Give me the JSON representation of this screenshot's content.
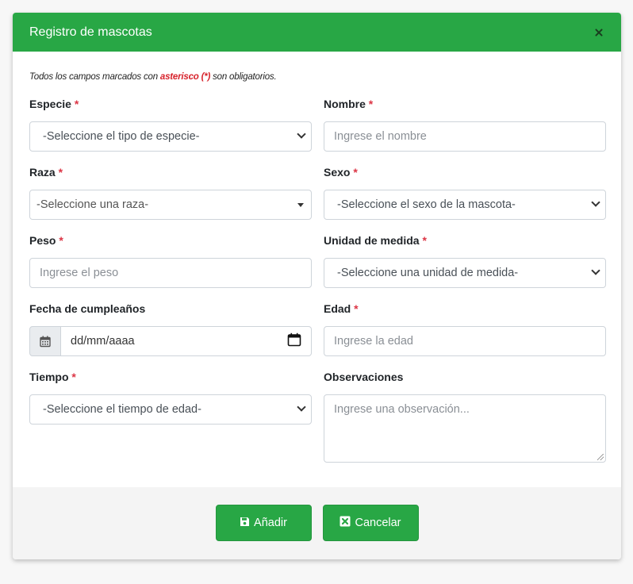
{
  "modal": {
    "title": "Registro de mascotas"
  },
  "note": {
    "prefix": "Todos los campos marcados con ",
    "highlight": "asterisco (*)",
    "suffix": " son obligatorios."
  },
  "fields": {
    "especie": {
      "label": "Especie",
      "required_mark": "*",
      "value": "-Seleccione el tipo de especie-"
    },
    "nombre": {
      "label": "Nombre",
      "required_mark": "*",
      "placeholder": "Ingrese el nombre"
    },
    "raza": {
      "label": "Raza",
      "required_mark": "*",
      "value": "-Seleccione una raza-"
    },
    "sexo": {
      "label": "Sexo",
      "required_mark": "*",
      "value": "-Seleccione el sexo de la mascota-"
    },
    "peso": {
      "label": "Peso",
      "required_mark": "*",
      "placeholder": "Ingrese el peso"
    },
    "unidad": {
      "label": "Unidad de medida",
      "required_mark": "*",
      "value": "-Seleccione una unidad de medida-"
    },
    "fecha": {
      "label": "Fecha de cumpleaños",
      "value": "dd/mm/aaaa"
    },
    "edad": {
      "label": "Edad",
      "required_mark": "*",
      "placeholder": "Ingrese la edad"
    },
    "tiempo": {
      "label": "Tiempo",
      "required_mark": "*",
      "value": "-Seleccione el tiempo de edad-"
    },
    "observaciones": {
      "label": "Observaciones",
      "placeholder": "Ingrese una observación..."
    }
  },
  "footer": {
    "add_label": "Añadir",
    "cancel_label": "Cancelar"
  },
  "colors": {
    "primary": "#28a745",
    "required": "#dc3545"
  }
}
